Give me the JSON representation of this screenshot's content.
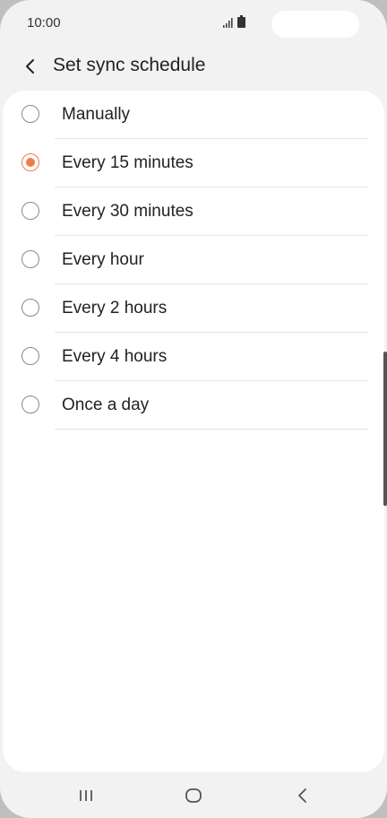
{
  "status_bar": {
    "time": "10:00",
    "signal_icon": "signal-icon",
    "battery_icon": "battery-icon"
  },
  "app_bar": {
    "back_icon": "chevron-left-icon",
    "title": "Set sync schedule"
  },
  "options": [
    {
      "label": "Manually",
      "selected": false
    },
    {
      "label": "Every 15 minutes",
      "selected": true
    },
    {
      "label": "Every 30 minutes",
      "selected": false
    },
    {
      "label": "Every hour",
      "selected": false
    },
    {
      "label": "Every 2 hours",
      "selected": false
    },
    {
      "label": "Every 4 hours",
      "selected": false
    },
    {
      "label": "Once a day",
      "selected": false
    }
  ],
  "nav_bar": {
    "recents_icon": "recents-icon",
    "home_icon": "home-icon",
    "back_icon": "back-icon"
  },
  "colors": {
    "accent": "#f07a4b",
    "background": "#f2f2f2",
    "card": "#ffffff"
  }
}
